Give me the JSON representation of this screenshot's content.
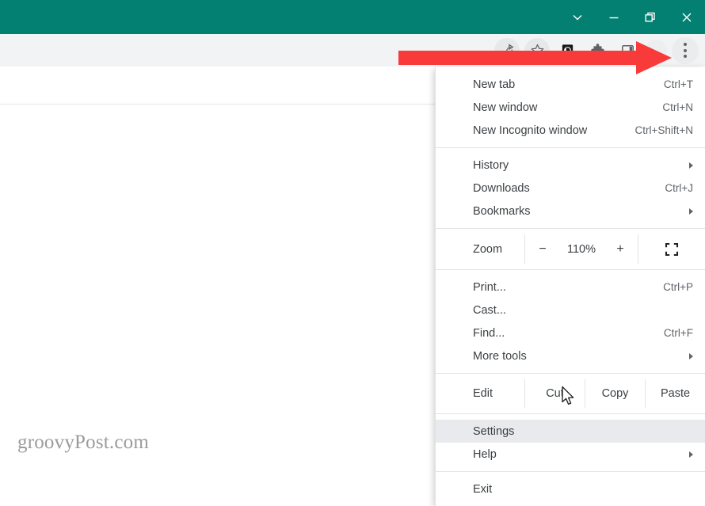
{
  "window": {
    "titlebar_color": "#038071",
    "toolbar_color": "#f1f3f4",
    "controls": [
      {
        "name": "chevron-down",
        "tooltip": "Search tabs"
      },
      {
        "name": "minimize",
        "tooltip": "Minimize"
      },
      {
        "name": "restore",
        "tooltip": "Restore"
      },
      {
        "name": "close",
        "tooltip": "Close"
      }
    ]
  },
  "toolbar": {
    "icons": [
      {
        "name": "share-icon",
        "label": "Share this page"
      },
      {
        "name": "star-icon",
        "label": "Bookmark this tab"
      },
      {
        "name": "extension-d-icon",
        "label": "D"
      },
      {
        "name": "puzzle-piece-icon",
        "label": "Extensions"
      },
      {
        "name": "side-panel-icon",
        "label": "Side panel"
      },
      {
        "name": "avatar-icon",
        "label": "Profile"
      },
      {
        "name": "three-dot-menu-icon",
        "label": "Customize and control Google Chrome"
      }
    ]
  },
  "page": {
    "watermark": "groovyPost.com"
  },
  "menu": {
    "highlight_color": "#e8eaed",
    "groups": [
      {
        "type": "items",
        "items": [
          {
            "label": "New tab",
            "accel": "Ctrl+T",
            "submenu": false,
            "highlight": false
          },
          {
            "label": "New window",
            "accel": "Ctrl+N",
            "submenu": false,
            "highlight": false
          },
          {
            "label": "New Incognito window",
            "accel": "Ctrl+Shift+N",
            "submenu": false,
            "highlight": false
          }
        ]
      },
      {
        "type": "items",
        "items": [
          {
            "label": "History",
            "accel": "",
            "submenu": true,
            "highlight": false
          },
          {
            "label": "Downloads",
            "accel": "Ctrl+J",
            "submenu": false,
            "highlight": false
          },
          {
            "label": "Bookmarks",
            "accel": "",
            "submenu": true,
            "highlight": false
          }
        ]
      },
      {
        "type": "zoom",
        "label": "Zoom",
        "minus": "−",
        "value": "110%",
        "plus": "+",
        "fullscreen_icon": "fullscreen-icon"
      },
      {
        "type": "items",
        "items": [
          {
            "label": "Print...",
            "accel": "Ctrl+P",
            "submenu": false,
            "highlight": false
          },
          {
            "label": "Cast...",
            "accel": "",
            "submenu": false,
            "highlight": false
          },
          {
            "label": "Find...",
            "accel": "Ctrl+F",
            "submenu": false,
            "highlight": false
          },
          {
            "label": "More tools",
            "accel": "",
            "submenu": true,
            "highlight": false
          }
        ]
      },
      {
        "type": "edit",
        "label": "Edit",
        "actions": [
          "Cut",
          "Copy",
          "Paste"
        ]
      },
      {
        "type": "items",
        "items": [
          {
            "label": "Settings",
            "accel": "",
            "submenu": false,
            "highlight": true
          },
          {
            "label": "Help",
            "accel": "",
            "submenu": true,
            "highlight": false
          }
        ]
      },
      {
        "type": "items",
        "items": [
          {
            "label": "Exit",
            "accel": "",
            "submenu": false,
            "highlight": false
          }
        ]
      }
    ]
  },
  "annotation": {
    "arrow_color": "#f83a3a",
    "points_to": "three-dot-menu-icon"
  }
}
